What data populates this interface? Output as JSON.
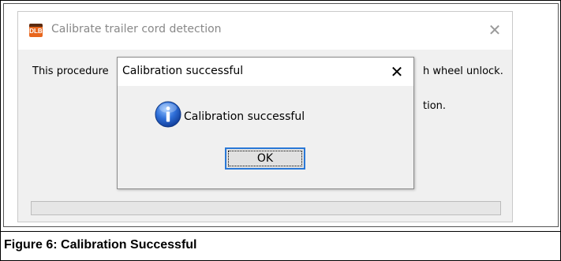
{
  "parent_window": {
    "app_icon_text": "DLB",
    "title": "Calibrate trailer cord detection",
    "close_glyph": "✕",
    "text_left": "This procedure",
    "text_right": "h wheel unlock.",
    "text_right2": "tion."
  },
  "message_box": {
    "title": "Calibration successful",
    "close_glyph": "✕",
    "icon": "info-icon",
    "message": "Calibration successful",
    "ok_label": "OK"
  },
  "caption": "Figure 6: Calibration Successful",
  "colors": {
    "accent": "#2a78d6",
    "app_icon": "#e8661d",
    "dialog_bg": "#f0f0f0"
  }
}
